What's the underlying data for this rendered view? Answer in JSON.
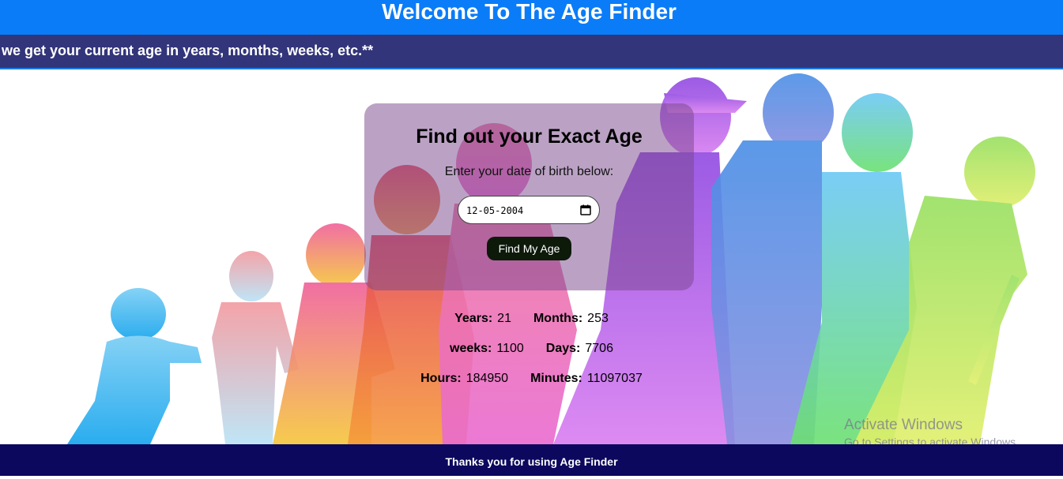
{
  "header": {
    "title": "Welcome To The Age Finder"
  },
  "marquee": {
    "text": "re we get your current age in years, months, weeks, etc.**"
  },
  "card": {
    "heading": "Find out your Exact Age",
    "prompt": "Enter your date of birth below:",
    "date_value": "12-05-2004",
    "button_label": "Find My Age"
  },
  "results": {
    "years_label": "Years:",
    "years": "21",
    "months_label": "Months:",
    "months": "253",
    "weeks_label": "weeks:",
    "weeks": "1100",
    "days_label": "Days:",
    "days": "7706",
    "hours_label": "Hours:",
    "hours": "184950",
    "minutes_label": "Minutes:",
    "minutes": "11097037"
  },
  "footer": {
    "text": "Thanks you for using Age Finder"
  },
  "watermark": {
    "line1": "Activate Windows",
    "line2": "Go to Settings to activate Windows."
  },
  "icons": {
    "calendar": "calendar-icon"
  },
  "colors": {
    "header_bg": "#0a7cf8",
    "marquee_bg": "#32357a",
    "footer_bg": "#0b085e",
    "button_bg": "#0d1a0a"
  }
}
